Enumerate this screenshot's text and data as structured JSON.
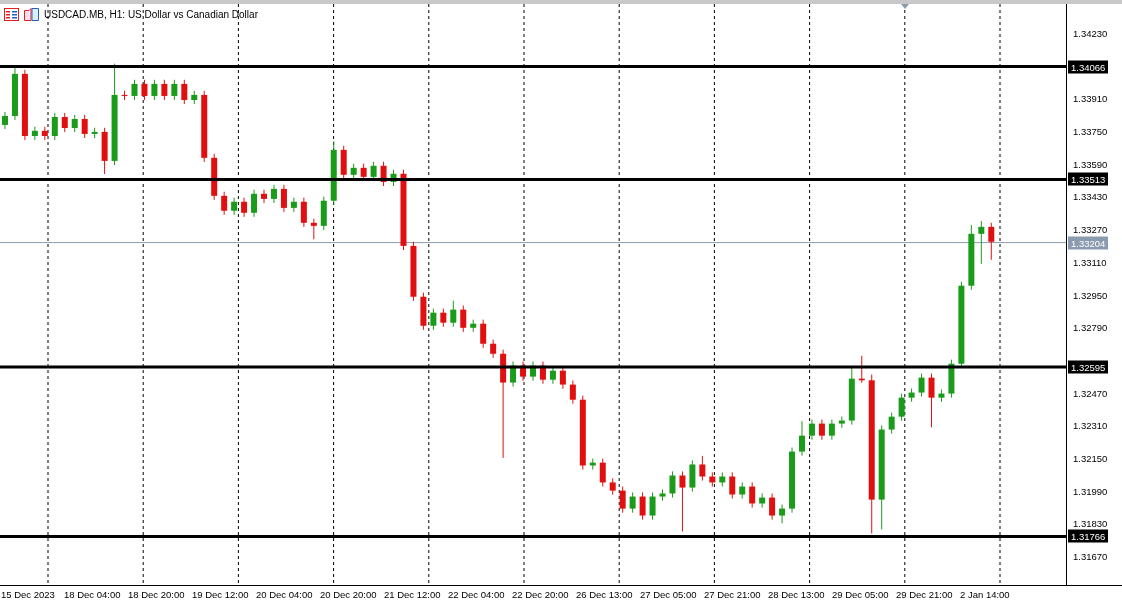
{
  "title": "USDCAD.MB, H1:  US Dollar vs Canadian Dollar",
  "levels": [
    {
      "price": "1.34066"
    },
    {
      "price": "1.33513"
    },
    {
      "price": "1.32595"
    },
    {
      "price": "1.31766"
    }
  ],
  "time_axis": {
    "labels": [
      "15 Dec 2023",
      "18 Dec 04:00",
      "18 Dec 20:00",
      "19 Dec 12:00",
      "20 Dec 04:00",
      "20 Dec 20:00",
      "21 Dec 12:00",
      "22 Dec 04:00",
      "22 Dec 20:00",
      "26 Dec 13:00",
      "27 Dec 05:00",
      "27 Dec 21:00",
      "28 Dec 13:00",
      "29 Dec 05:00",
      "29 Dec 21:00",
      "2 Jan 14:00"
    ]
  },
  "chart_data": {
    "type": "candlestick",
    "ylim": [
      1.31528,
      1.34372
    ],
    "yticks": [
      {
        "value": 1.3423,
        "label": "1.34230"
      },
      {
        "value": 1.3391,
        "label": "1.33910"
      },
      {
        "value": 1.3375,
        "label": "1.33750"
      },
      {
        "value": 1.3359,
        "label": "1.33590"
      },
      {
        "value": 1.3343,
        "label": "1.33430"
      },
      {
        "value": 1.3327,
        "label": "1.33270"
      },
      {
        "value": 1.3311,
        "label": "1.33110"
      },
      {
        "value": 1.3295,
        "label": "1.32950"
      },
      {
        "value": 1.3279,
        "label": "1.32790"
      },
      {
        "value": 1.3247,
        "label": "1.32470"
      },
      {
        "value": 1.3231,
        "label": "1.32310"
      },
      {
        "value": 1.3215,
        "label": "1.32150"
      },
      {
        "value": 1.3199,
        "label": "1.31990"
      },
      {
        "value": 1.3183,
        "label": "1.31830"
      },
      {
        "value": 1.3167,
        "label": "1.31670"
      }
    ],
    "categories": [
      null,
      null,
      null,
      null,
      null,
      null,
      null,
      null,
      null,
      null,
      null,
      null,
      null,
      null,
      null,
      null,
      null,
      null,
      null,
      null,
      null,
      null,
      null,
      null,
      null,
      null,
      null,
      null,
      null,
      null,
      null,
      null,
      null,
      null,
      null,
      null,
      null,
      null,
      null,
      null,
      null,
      null,
      null,
      null,
      null,
      null,
      null,
      null,
      null,
      null,
      null,
      null,
      null,
      null,
      null,
      null,
      null,
      null,
      null,
      null,
      null,
      null,
      null,
      null,
      null,
      null,
      null,
      null,
      null,
      null,
      null,
      null,
      null,
      null,
      null,
      null,
      null,
      null,
      null,
      null,
      null,
      null,
      null,
      null,
      null,
      null,
      null,
      null,
      null,
      null,
      null,
      null,
      null,
      null,
      null,
      null,
      null,
      null,
      null,
      null,
      null,
      null,
      null,
      null,
      null,
      null,
      null
    ],
    "ref_lines": [
      {
        "axis": "y",
        "value": 1.33204,
        "label": "1.33204",
        "color": "#8a9bb0"
      }
    ],
    "ohlc": [
      [
        1.3378,
        1.33844,
        1.3376,
        1.33824
      ],
      [
        1.33824,
        1.3406,
        1.33804,
        1.3403
      ],
      [
        1.3403,
        1.3405,
        1.33706,
        1.33726
      ],
      [
        1.33726,
        1.33771,
        1.33706,
        1.33751
      ],
      [
        1.33751,
        1.33771,
        1.33706,
        1.33726
      ],
      [
        1.33726,
        1.33839,
        1.33706,
        1.33819
      ],
      [
        1.33819,
        1.33839,
        1.33745,
        1.33765
      ],
      [
        1.33765,
        1.33829,
        1.33745,
        1.33809
      ],
      [
        1.33809,
        1.33829,
        1.33716,
        1.33736
      ],
      [
        1.33736,
        1.33766,
        1.33716,
        1.33746
      ],
      [
        1.33746,
        1.33766,
        1.3354,
        1.33604
      ],
      [
        1.33604,
        1.3408,
        1.33584,
        1.33927
      ],
      [
        1.33927,
        1.33947,
        1.33902,
        1.33922
      ],
      [
        1.33922,
        1.34001,
        1.33902,
        1.33981
      ],
      [
        1.33981,
        1.34001,
        1.33902,
        1.33922
      ],
      [
        1.33922,
        1.34001,
        1.33902,
        1.33981
      ],
      [
        1.33981,
        1.34001,
        1.33902,
        1.33922
      ],
      [
        1.33922,
        1.34001,
        1.33902,
        1.33981
      ],
      [
        1.33981,
        1.34001,
        1.33882,
        1.33902
      ],
      [
        1.33902,
        1.33947,
        1.33882,
        1.33927
      ],
      [
        1.33927,
        1.33947,
        1.33599,
        1.33619
      ],
      [
        1.33619,
        1.33639,
        1.33413,
        1.33433
      ],
      [
        1.33433,
        1.33453,
        1.3334,
        1.3336
      ],
      [
        1.3336,
        1.33424,
        1.3334,
        1.33404
      ],
      [
        1.33404,
        1.33424,
        1.3333,
        1.3335
      ],
      [
        1.3335,
        1.33463,
        1.3333,
        1.33443
      ],
      [
        1.33443,
        1.33463,
        1.33398,
        1.33418
      ],
      [
        1.33418,
        1.33487,
        1.33398,
        1.33467
      ],
      [
        1.33467,
        1.33487,
        1.33354,
        1.33374
      ],
      [
        1.33374,
        1.33424,
        1.33354,
        1.33404
      ],
      [
        1.33404,
        1.33424,
        1.33281,
        1.33301
      ],
      [
        1.33301,
        1.33321,
        1.3322,
        1.33286
      ],
      [
        1.33286,
        1.33429,
        1.33266,
        1.33409
      ],
      [
        1.33409,
        1.337,
        1.33389,
        1.33658
      ],
      [
        1.33658,
        1.33678,
        1.33516,
        1.33536
      ],
      [
        1.33536,
        1.3359,
        1.33516,
        1.3357
      ],
      [
        1.3357,
        1.3359,
        1.33506,
        1.33526
      ],
      [
        1.33526,
        1.336,
        1.33506,
        1.3358
      ],
      [
        1.3358,
        1.336,
        1.33481,
        1.33501
      ],
      [
        1.33501,
        1.33561,
        1.33481,
        1.33541
      ],
      [
        1.33541,
        1.33561,
        1.33168,
        1.33188
      ],
      [
        1.33188,
        1.33208,
        1.32919,
        1.32939
      ],
      [
        1.32939,
        1.32959,
        1.32777,
        1.32797
      ],
      [
        1.32797,
        1.32881,
        1.32777,
        1.32861
      ],
      [
        1.32861,
        1.32881,
        1.32792,
        1.32812
      ],
      [
        1.32812,
        1.3292,
        1.32792,
        1.32876
      ],
      [
        1.32876,
        1.32896,
        1.32767,
        1.32787
      ],
      [
        1.32787,
        1.32827,
        1.32767,
        1.32807
      ],
      [
        1.32807,
        1.32827,
        1.32689,
        1.32709
      ],
      [
        1.32709,
        1.32729,
        1.3264,
        1.3266
      ],
      [
        1.3266,
        1.3268,
        1.3215,
        1.32519
      ],
      [
        1.32519,
        1.32622,
        1.32499,
        1.32602
      ],
      [
        1.32602,
        1.32622,
        1.32528,
        1.32548
      ],
      [
        1.32548,
        1.32622,
        1.32528,
        1.32602
      ],
      [
        1.32602,
        1.32622,
        1.32513,
        1.32533
      ],
      [
        1.32533,
        1.326,
        1.32513,
        1.32577
      ],
      [
        1.32577,
        1.32597,
        1.32489,
        1.32509
      ],
      [
        1.32509,
        1.32529,
        1.32415,
        1.32435
      ],
      [
        1.32435,
        1.32455,
        1.32093,
        1.32113
      ],
      [
        1.32113,
        1.32147,
        1.32093,
        1.32127
      ],
      [
        1.32127,
        1.32147,
        1.3201,
        1.3203
      ],
      [
        1.3203,
        1.3205,
        1.3197,
        1.3199
      ],
      [
        1.3199,
        1.3201,
        1.31882,
        1.31902
      ],
      [
        1.31902,
        1.31981,
        1.31882,
        1.31961
      ],
      [
        1.31961,
        1.31981,
        1.31848,
        1.31868
      ],
      [
        1.31868,
        1.31981,
        1.31848,
        1.31961
      ],
      [
        1.31961,
        1.31996,
        1.31941,
        1.31976
      ],
      [
        1.31976,
        1.32084,
        1.31956,
        1.32064
      ],
      [
        1.32064,
        1.32084,
        1.3179,
        1.32005
      ],
      [
        1.32005,
        1.32138,
        1.31985,
        1.32118
      ],
      [
        1.32118,
        1.3216,
        1.32039,
        1.32059
      ],
      [
        1.32059,
        1.32079,
        1.3201,
        1.3203
      ],
      [
        1.3203,
        1.32079,
        1.3201,
        1.32059
      ],
      [
        1.32059,
        1.32079,
        1.31951,
        1.31971
      ],
      [
        1.31971,
        1.3203,
        1.31951,
        1.3201
      ],
      [
        1.3201,
        1.3203,
        1.31907,
        1.31927
      ],
      [
        1.31927,
        1.31976,
        1.31907,
        1.31956
      ],
      [
        1.31956,
        1.31976,
        1.31848,
        1.31868
      ],
      [
        1.31868,
        1.31922,
        1.3183,
        1.31902
      ],
      [
        1.31902,
        1.32201,
        1.31882,
        1.32181
      ],
      [
        1.32181,
        1.3233,
        1.32161,
        1.32259
      ],
      [
        1.32259,
        1.32338,
        1.32239,
        1.32318
      ],
      [
        1.32318,
        1.32338,
        1.32239,
        1.32259
      ],
      [
        1.32259,
        1.32338,
        1.32239,
        1.32318
      ],
      [
        1.32318,
        1.32353,
        1.32298,
        1.32333
      ],
      [
        1.32333,
        1.326,
        1.32313,
        1.32538
      ],
      [
        1.32538,
        1.3265,
        1.32518,
        1.3253
      ],
      [
        1.3253,
        1.32558,
        1.3178,
        1.31946
      ],
      [
        1.31946,
        1.32309,
        1.318,
        1.32289
      ],
      [
        1.32289,
        1.32372,
        1.32269,
        1.32352
      ],
      [
        1.32352,
        1.32465,
        1.32332,
        1.32445
      ],
      [
        1.32445,
        1.3249,
        1.32425,
        1.3247
      ],
      [
        1.3247,
        1.32563,
        1.3245,
        1.32543
      ],
      [
        1.32543,
        1.32563,
        1.323,
        1.32445
      ],
      [
        1.32445,
        1.32485,
        1.32425,
        1.32465
      ],
      [
        1.32465,
        1.32631,
        1.32445,
        1.32611
      ],
      [
        1.32611,
        1.33013,
        1.32591,
        1.32993
      ],
      [
        1.32993,
        1.3329,
        1.32973,
        1.33247
      ],
      [
        1.33247,
        1.3331,
        1.331,
        1.33281
      ],
      [
        1.33281,
        1.33301,
        1.3312,
        1.33208
      ],
      null,
      null,
      null,
      null,
      null,
      null,
      null
    ]
  }
}
